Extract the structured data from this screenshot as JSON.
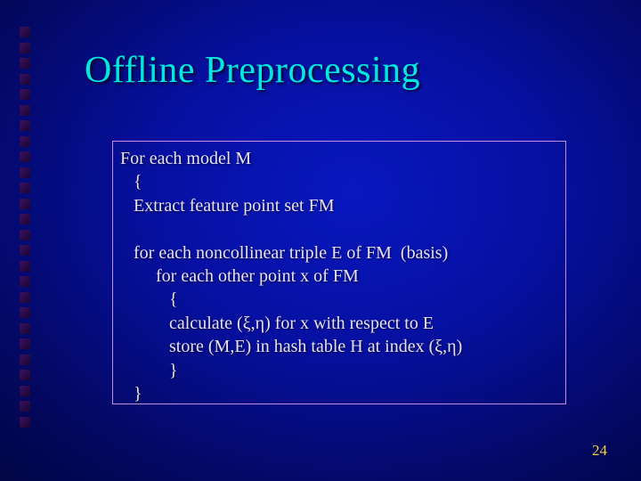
{
  "slide": {
    "title": "Offline Preprocessing",
    "page_number": "24",
    "code_lines": [
      "For each model M",
      "   {",
      "   Extract feature point set FM",
      "",
      "   for each noncollinear triple E of FM  (basis)",
      "        for each other point x of FM",
      "           {",
      "           calculate (ξ,η) for x with respect to E",
      "           store (M,E) in hash table H at index (ξ,η)",
      "           }",
      "   }"
    ],
    "bullet_count": 26
  },
  "colors": {
    "title": "#00e8e0",
    "body_text": "#e8e0f0",
    "page_number": "#f0d060",
    "box_border": "#c090e8"
  }
}
